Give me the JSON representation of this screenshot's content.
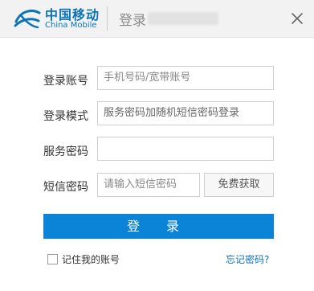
{
  "header": {
    "brand_cn": "中国移动",
    "brand_en": "China Mobile",
    "title": "登录"
  },
  "form": {
    "account": {
      "label": "登录账号",
      "placeholder": "手机号码/宽带账号"
    },
    "mode": {
      "label": "登录模式",
      "value": "服务密码加随机短信密码登录"
    },
    "service_password": {
      "label": "服务密码",
      "value": ""
    },
    "sms_password": {
      "label": "短信密码",
      "placeholder": "请输入短信密码",
      "button": "免费获取"
    }
  },
  "login_button": "登 录",
  "remember_label": "记住我的账号",
  "forgot_link": "忘记密码?",
  "colors": {
    "accent": "#0b83d6",
    "brand": "#0b74b7",
    "header_bg": "#f2f2f2"
  },
  "icons": {
    "logo": "china-mobile-logo-icon",
    "close": "close-icon"
  }
}
